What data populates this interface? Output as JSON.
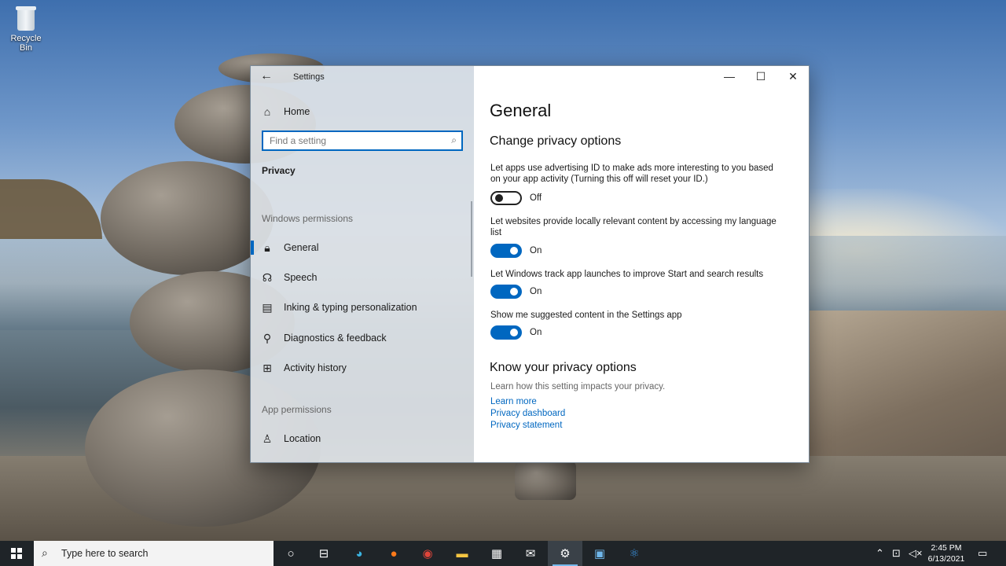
{
  "desktop": {
    "recycle_bin_label": "Recycle Bin"
  },
  "window": {
    "title": "Settings",
    "minimize": "—",
    "maximize": "☐",
    "close": "✕"
  },
  "sidebar": {
    "home_label": "Home",
    "search_placeholder": "Find a setting",
    "breadcrumb": "Privacy",
    "section_windows": "Windows permissions",
    "section_app": "App permissions",
    "items": [
      {
        "label": "General",
        "icon": "lock-icon"
      },
      {
        "label": "Speech",
        "icon": "speech-icon"
      },
      {
        "label": "Inking & typing personalization",
        "icon": "inking-icon"
      },
      {
        "label": "Diagnostics & feedback",
        "icon": "diagnostics-icon"
      },
      {
        "label": "Activity history",
        "icon": "activity-icon"
      }
    ],
    "app_items": [
      {
        "label": "Location",
        "icon": "location-icon"
      }
    ]
  },
  "main": {
    "title": "General",
    "change_heading": "Change privacy options",
    "options": [
      {
        "text": "Let apps use advertising ID to make ads more interesting to you based on your app activity (Turning this off will reset your ID.)",
        "state": "Off",
        "on": false
      },
      {
        "text": "Let websites provide locally relevant content by accessing my language list",
        "state": "On",
        "on": true
      },
      {
        "text": "Let Windows track app launches to improve Start and search results",
        "state": "On",
        "on": true
      },
      {
        "text": "Show me suggested content in the Settings app",
        "state": "On",
        "on": true
      }
    ],
    "know_heading": "Know your privacy options",
    "know_desc": "Learn how this setting impacts your privacy.",
    "links": [
      "Learn more",
      "Privacy dashboard",
      "Privacy statement"
    ]
  },
  "taskbar": {
    "search_placeholder": "Type here to search",
    "time": "2:45 PM",
    "date": "6/13/2021"
  },
  "colors": {
    "accent": "#0067c0",
    "taskbar": "#1f2428"
  }
}
